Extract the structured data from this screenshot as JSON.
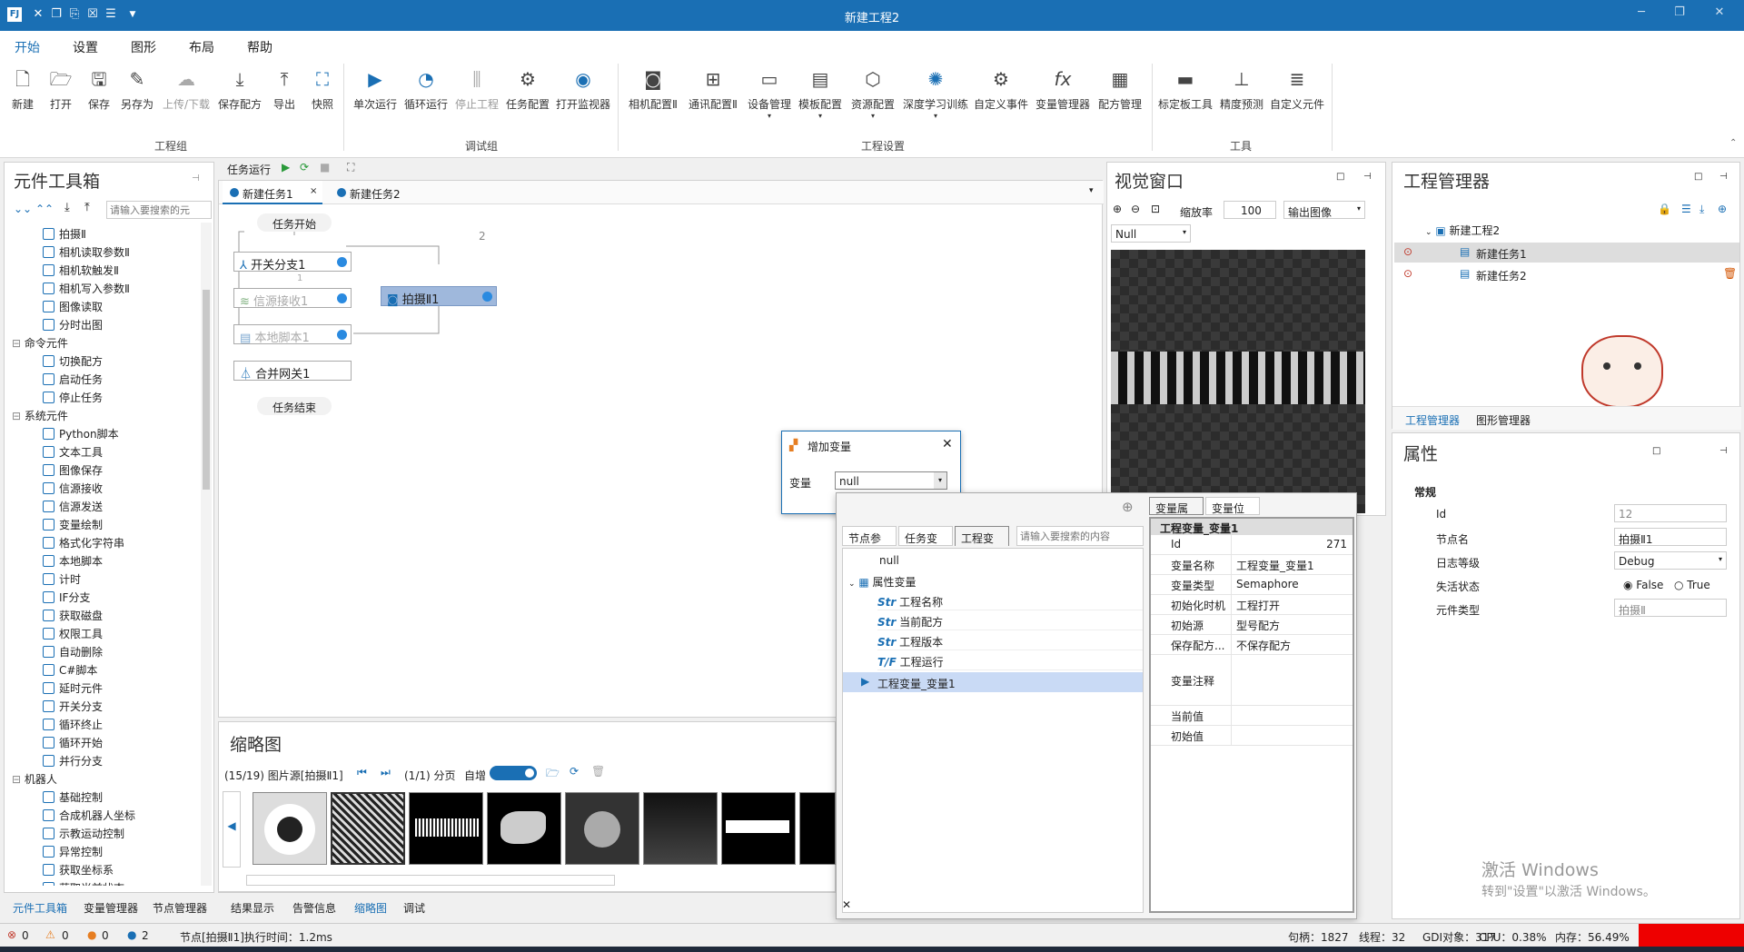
{
  "app": {
    "title": "新建工程2"
  },
  "menu": [
    "开始",
    "设置",
    "图形",
    "布局",
    "帮助"
  ],
  "ribbon": {
    "groups": [
      "工程组",
      "调试组",
      "工程设置",
      "工具"
    ],
    "project": [
      "新建",
      "打开",
      "保存",
      "另存为",
      "上传/下载",
      "保存配方",
      "导出",
      "快照"
    ],
    "debug": [
      "单次运行",
      "循环运行",
      "停止工程",
      "任务配置",
      "打开监视器"
    ],
    "settings": [
      "相机配置Ⅱ",
      "通讯配置Ⅱ",
      "设备管理",
      "模板配置",
      "资源配置",
      "深度学习训练",
      "自定义事件",
      "变量管理器",
      "配方管理"
    ],
    "tools": [
      "标定板工具",
      "精度预测",
      "自定义元件"
    ]
  },
  "toolbox": {
    "title": "元件工具箱",
    "search_placeholder": "请输入要搜索的元",
    "items": [
      "拍摄Ⅱ",
      "相机读取参数Ⅱ",
      "相机软触发Ⅱ",
      "相机写入参数Ⅱ",
      "图像读取",
      "分时出图",
      "命令元件",
      "切换配方",
      "启动任务",
      "停止任务",
      "系统元件",
      "Python脚本",
      "文本工具",
      "图像保存",
      "信源接收",
      "信源发送",
      "变量绘制",
      "格式化字符串",
      "本地脚本",
      "计时",
      "IF分支",
      "获取磁盘",
      "权限工具",
      "自动删除",
      "C#脚本",
      "延时元件",
      "开关分支",
      "循环终止",
      "循环开始",
      "并行分支",
      "机器人",
      "基础控制",
      "合成机器人坐标",
      "示教运动控制",
      "异常控制",
      "获取坐标系",
      "获取当前状态"
    ],
    "bottom_tabs": [
      "元件工具箱",
      "变量管理器",
      "节点管理器"
    ]
  },
  "task": {
    "run_label": "任务运行",
    "tabs": [
      "新建任务1",
      "新建任务2"
    ],
    "nodes": {
      "start": "任务开始",
      "branch": "开关分支1",
      "recv": "信源接收1",
      "script": "本地脚本1",
      "merge": "合并网关1",
      "end": "任务结束",
      "shot": "拍摄Ⅱ1"
    },
    "branch_labels": [
      "1",
      "2"
    ]
  },
  "thumbnail": {
    "title": "缩略图",
    "source": "(15/19) 图片源[拍摄Ⅱ1]",
    "page": "(1/1) 分页",
    "auto_label": "自增",
    "bottom_tabs": [
      "结果显示",
      "告警信息",
      "缩略图",
      "调试"
    ]
  },
  "vision": {
    "title": "视觉窗口",
    "zoom_label": "缩放率",
    "zoom_value": "100",
    "output": "输出图像",
    "null_select": "Null"
  },
  "project_mgr": {
    "title": "工程管理器",
    "root": "新建工程2",
    "tasks": [
      "新建任务1",
      "新建任务2"
    ],
    "tabs": [
      "工程管理器",
      "图形管理器"
    ]
  },
  "properties": {
    "title": "属性",
    "section": "常规",
    "rows": [
      {
        "k": "Id",
        "v": "12"
      },
      {
        "k": "节点名",
        "v": "拍摄Ⅱ1"
      },
      {
        "k": "日志等级",
        "v": "Debug"
      },
      {
        "k": "失活状态",
        "v": ""
      },
      {
        "k": "元件类型",
        "v": "拍摄Ⅱ"
      }
    ],
    "false_label": "False",
    "true_label": "True"
  },
  "dialog_add": {
    "title": "增加变量",
    "var_label": "变量",
    "var_value": "null"
  },
  "var_popup": {
    "tabs": [
      "节点参数",
      "任务变量",
      "工程变量"
    ],
    "search_placeholder": "请输入要搜索的内容",
    "tree": {
      "null_item": "null",
      "group": "属性变量",
      "children": [
        "工程名称",
        "当前配方",
        "工程版本",
        "工程运行"
      ],
      "selected": "工程变量_变量1"
    },
    "right_tabs": [
      "变量属性",
      "变量位置"
    ],
    "prop_header": "工程变量_变量1",
    "props": [
      {
        "k": "Id",
        "v": "271"
      },
      {
        "k": "变量名称",
        "v": "工程变量_变量1"
      },
      {
        "k": "变量类型",
        "v": "Semaphore"
      },
      {
        "k": "初始化时机",
        "v": "工程打开"
      },
      {
        "k": "初始源",
        "v": "型号配方"
      },
      {
        "k": "保存配方...",
        "v": "不保存配方"
      },
      {
        "k": "变量注释",
        "v": ""
      },
      {
        "k": "当前值",
        "v": ""
      },
      {
        "k": "初始值",
        "v": ""
      }
    ]
  },
  "status": {
    "counts": [
      "0",
      "0",
      "0",
      "2"
    ],
    "message": "节点[拍摄Ⅱ1]执行时间：1.2ms",
    "handles": "句柄：1827",
    "threads": "线程：32",
    "gdi": "GDI对象：317",
    "cpu": "CPU：0.38%",
    "mem": "内存：56.49%"
  },
  "watermark": {
    "line1": "激活 Windows",
    "line2": "转到\"设置\"以激活 Windows。"
  },
  "colors": {
    "accent": "#1a6fb4",
    "selection": "#c9daf5",
    "node_selected": "#9fb8dc"
  }
}
